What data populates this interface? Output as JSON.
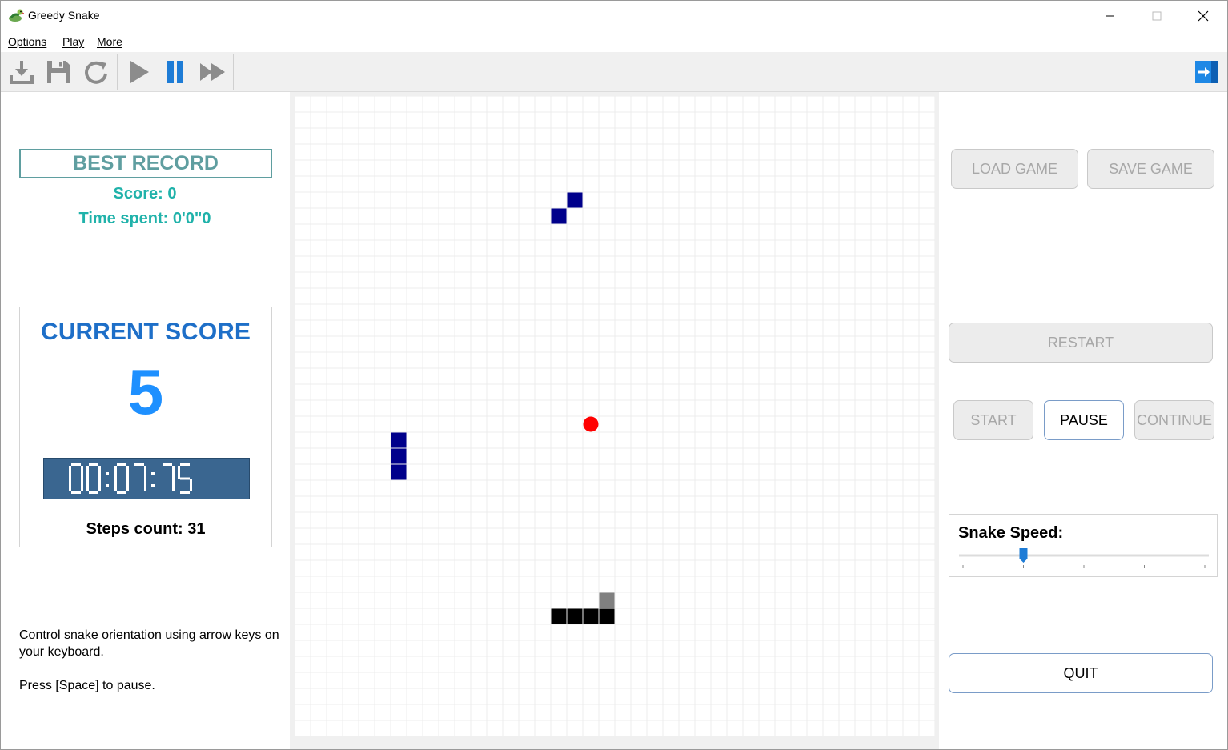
{
  "window": {
    "title": "Greedy Snake"
  },
  "menu": [
    {
      "label": "Options"
    },
    {
      "label": "Play"
    },
    {
      "label": "More"
    }
  ],
  "toolbar": {
    "buttons": [
      {
        "icon": "download-icon"
      },
      {
        "icon": "save-icon"
      },
      {
        "icon": "refresh-icon"
      },
      {
        "icon": "play-icon"
      },
      {
        "icon": "pause-icon"
      },
      {
        "icon": "fast-forward-icon"
      }
    ],
    "right_icon": "exit-icon"
  },
  "best_record": {
    "title": "BEST RECORD",
    "score": "Score: 0",
    "time": "Time spent: 0'0\"0"
  },
  "current": {
    "title": "CURRENT SCORE",
    "value": "5",
    "timer": "00:07:75",
    "steps": "Steps count: 31"
  },
  "help": {
    "line1": "Control snake orientation using arrow keys on your keyboard.",
    "line2": "Press [Space] to pause."
  },
  "buttons": {
    "load": "LOAD GAME",
    "save": "SAVE GAME",
    "restart": "RESTART",
    "start": "START",
    "pause": "PAUSE",
    "continue": "CONTINUE",
    "quit": "QUIT"
  },
  "speed": {
    "label": "Snake Speed:",
    "value": 1,
    "max": 4
  },
  "game": {
    "grid": 40,
    "food": [
      18,
      20
    ],
    "snake_head": [
      19,
      31
    ],
    "snake_body": [
      [
        19,
        32
      ],
      [
        18,
        32
      ],
      [
        17,
        32
      ],
      [
        16,
        32
      ]
    ],
    "obstacles": [
      [
        17,
        6
      ],
      [
        16,
        7
      ],
      [
        6,
        21
      ],
      [
        6,
        22
      ],
      [
        6,
        23
      ]
    ]
  },
  "colors": {
    "accent": "#1e90ff",
    "best": "#5f9ea0",
    "best_text": "#20b2aa",
    "timer_bg": "#3a6690",
    "obstacle": "#00008b",
    "food": "#ff0000",
    "snake_body": "#000000",
    "snake_head": "#808080"
  }
}
